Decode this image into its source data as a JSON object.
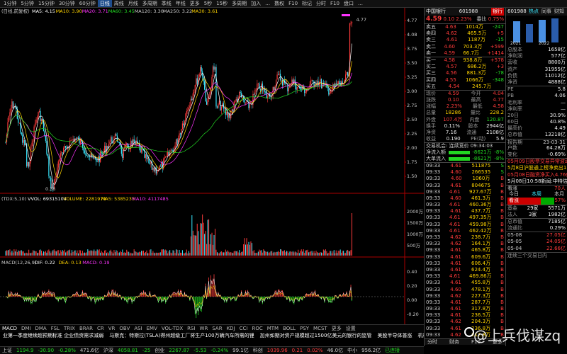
{
  "menubar": {
    "items": [
      "1分钟",
      "5分钟",
      "15分钟",
      "30分钟",
      "60分钟",
      "日线",
      "周线",
      "月线",
      "多周期",
      "季线",
      "年线",
      "更多",
      "5秒",
      "15秒",
      "多周期",
      "加入",
      "…",
      "数权",
      "F10",
      "标记",
      "分时",
      "F10",
      "盘口",
      "…"
    ],
    "active_index": 5
  },
  "chart": {
    "info": "(日线,前复权)",
    "ma_labels": [
      {
        "text": "MA5: 4.15",
        "color": "#ffffff"
      },
      {
        "text": "MA10: 3.90",
        "color": "#ffd400"
      },
      {
        "text": "MA20: 3.71",
        "color": "#ff33ff"
      },
      {
        "text": "MA60: 3.45",
        "color": "#22d822"
      },
      {
        "text": "MA120: 3.30",
        "color": "#cccccc"
      },
      {
        "text": "MA250: 3.22",
        "color": "#cccccc"
      },
      {
        "text": "MA30: 3.61",
        "color": "#ffd400"
      }
    ],
    "price_axis": [
      "4.77",
      "4.08",
      "3.75",
      "3.50",
      "3.25",
      "3.00",
      "2.75",
      "2.50",
      "2.25",
      "2.00",
      "1.75",
      "1.50"
    ],
    "high_label": "4.77",
    "low_label": "0.36",
    "vol_labels": [
      {
        "text": "(TDX:5,10)",
        "color": "#cccccc"
      },
      {
        "text": "VVOL: 69315104",
        "color": "#ffffff"
      },
      {
        "text": "VOLUME: 2281979",
        "color": "#ffd400"
      },
      {
        "text": "MA5: 5385235",
        "color": "#ffd400"
      },
      {
        "text": "MA10: 4117485",
        "color": "#ff33ff"
      }
    ],
    "vol_axis": [
      "2000万",
      "1500万",
      "1000万",
      "500万"
    ],
    "macd_labels": [
      {
        "text": "MACD(12,26,9)",
        "color": "#cccccc"
      },
      {
        "text": "DIF: 0.22",
        "color": "#ffffff"
      },
      {
        "text": "DEA: 0.13",
        "color": "#ffd400"
      },
      {
        "text": "MACD: 0.19",
        "color": "#ff33ff"
      }
    ],
    "macd_axis": [
      "0.40",
      "0.20",
      "0.00",
      "-0.20"
    ],
    "date_axis": [
      "04/29",
      "05/22"
    ]
  },
  "subtabs": [
    "MACD",
    "DMI",
    "DMA",
    "FSL",
    "TRIX",
    "BRAR",
    "CR",
    "VR",
    "OBV",
    "ASI",
    "EMV",
    "VOL-TDX",
    "RSI",
    "WR",
    "SAR",
    "KDJ",
    "CCI",
    "ROC",
    "MTM",
    "BOLL",
    "PSY",
    "MCST",
    "更多",
    "设置"
  ],
  "ticker": {
    "items": [
      {
        "text": "业第一季度继续超预期标准 企业债资需求减弱",
        "color": "#ffffff"
      },
      {
        "text": "马斯克：特斯拉(TSLA)得州超级工厂将生产100万辆汽车所需的锂",
        "color": "#ffffff"
      },
      {
        "text": "加州如期对资产规模超过1500亿美元的银行的监管",
        "color": "#ffffff"
      },
      {
        "text": "美股半导体普涨",
        "color": "#ffffff"
      },
      {
        "text": "机构：汽油价格双向波动趋于正常三个月",
        "color": "#ffffff"
      }
    ]
  },
  "status": {
    "items": [
      {
        "text": "上证",
        "color": "#cccccc"
      },
      {
        "text": "1194.9",
        "color": "#22d822"
      },
      {
        "text": "-30.90",
        "color": "#22d822"
      },
      {
        "text": "-0.28%",
        "color": "#22d822"
      },
      {
        "text": "471.6亿",
        "color": "#cccccc"
      },
      {
        "text": "沪深",
        "color": "#cccccc"
      },
      {
        "text": "4058.81",
        "color": "#22d822"
      },
      {
        "text": "-25",
        "color": "#22d822"
      },
      {
        "text": "创业",
        "color": "#cccccc"
      },
      {
        "text": "2267.87",
        "color": "#22d822"
      },
      {
        "text": "-5.53",
        "color": "#22d822"
      },
      {
        "text": "-0.24%",
        "color": "#22d822"
      },
      {
        "text": "99.1亿",
        "color": "#cccccc"
      },
      {
        "text": "科创",
        "color": "#cccccc"
      },
      {
        "text": "1039.96",
        "color": "#ff3b3b"
      },
      {
        "text": "0.21",
        "color": "#ff3b3b"
      },
      {
        "text": "0.02%",
        "color": "#ff3b3b"
      },
      {
        "text": "46.0亿",
        "color": "#cccccc"
      },
      {
        "text": "中小",
        "color": "#cccccc"
      },
      {
        "text": "956.2亿",
        "color": "#cccccc"
      },
      {
        "text": "已连接",
        "color": "#22d822"
      }
    ]
  },
  "quote": {
    "name": "中国银行",
    "code": "601988",
    "tag": "银行",
    "price": "4.59",
    "change": "0.10",
    "change_pct": "2.23%",
    "weibi": "委比",
    "weibi_val": "0.75%",
    "asks": [
      {
        "label": "卖五",
        "price": "4.63",
        "vol": "1014万",
        "chg": "-247"
      },
      {
        "label": "卖四",
        "price": "4.62",
        "vol": "465.5万",
        "chg": "+5"
      },
      {
        "label": "卖三",
        "price": "4.61",
        "vol": "1187万",
        "chg": "-15"
      },
      {
        "label": "卖二",
        "price": "4.60",
        "vol": "703.3万",
        "chg": "+599"
      },
      {
        "label": "卖一",
        "price": "4.59",
        "vol": "66.7万",
        "chg": "+1414"
      }
    ],
    "bids": [
      {
        "label": "买一",
        "price": "4.58",
        "vol": "938.8万",
        "chg": "+578"
      },
      {
        "label": "买二",
        "price": "4.57",
        "vol": "686.2万",
        "chg": "+3"
      },
      {
        "label": "买三",
        "price": "4.56",
        "vol": "881.3万",
        "chg": "-78"
      },
      {
        "label": "买四",
        "price": "4.55",
        "vol": "1066万",
        "chg": "-348"
      },
      {
        "label": "买五",
        "price": "4.54",
        "vol": "245.7万",
        "chg": ""
      }
    ],
    "stats": [
      {
        "l": "现价",
        "v": "4.59",
        "c": "#ff3b3b",
        "l2": "今开",
        "v2": "4.04",
        "c2": "#ff3b3b"
      },
      {
        "l": "涨跌",
        "v": "0.10",
        "c": "#ff3b3b",
        "l2": "最高",
        "v2": "4.77",
        "c2": "#ff3b3b"
      },
      {
        "l": "涨幅",
        "v": "2.23%",
        "c": "#ff3b3b",
        "l2": "最低",
        "v2": "4.58",
        "c2": "#ff3b3b"
      },
      {
        "l": "总量",
        "v": "18286",
        "c": "#ffd400",
        "l2": "量比",
        "v2": "228.2",
        "c2": "#ffd400"
      },
      {
        "l": "外盘",
        "v": "107.4万",
        "c": "#ff3b3b",
        "l2": "内盘",
        "v2": "120.87",
        "c2": "#22d822"
      },
      {
        "l": "换手",
        "v": "0.11%",
        "c": "#eee",
        "l2": "股本",
        "v2": "2944亿",
        "c2": "#eee"
      },
      {
        "l": "净资",
        "v": "7.16",
        "c": "#eee",
        "l2": "流通",
        "v2": "2108亿",
        "c2": "#eee"
      },
      {
        "l": "收益",
        "v": "0.190",
        "c": "#eee",
        "l2": "PE(动)",
        "v2": "5.9",
        "c2": "#eee"
      }
    ],
    "flow_title": "交易机会: 连续竞价 09:34:03",
    "flows": [
      {
        "label": "净流入额",
        "val": "-8621万",
        "pct": "-8%"
      },
      {
        "label": "大单流入",
        "val": "-8621万",
        "pct": "-8%"
      }
    ],
    "ticks": [
      {
        "t": "09:33",
        "p": "4.61",
        "v": "511875",
        "d": "S"
      },
      {
        "t": "09:33",
        "p": "4.60",
        "v": "266535",
        "d": "S"
      },
      {
        "t": "09:33",
        "p": "4.60",
        "v": "1060万",
        "d": "B"
      },
      {
        "t": "09:33",
        "p": "4.61",
        "v": "804675",
        "d": "B"
      },
      {
        "t": "09:33",
        "p": "4.61",
        "v": "927.67万",
        "d": "B"
      },
      {
        "t": "09:33",
        "p": "4.60",
        "v": "461.3万",
        "d": "B"
      },
      {
        "t": "09:33",
        "p": "4.61",
        "v": "460.36万",
        "d": "B"
      },
      {
        "t": "09:33",
        "p": "4.61",
        "v": "437.7万",
        "d": "B"
      },
      {
        "t": "09:33",
        "p": "4.61",
        "v": "497.35万",
        "d": "B"
      },
      {
        "t": "09:33",
        "p": "4.61",
        "v": "459.98万",
        "d": "B"
      },
      {
        "t": "09:33",
        "p": "4.61",
        "v": "462.42万",
        "d": "B"
      },
      {
        "t": "09:33",
        "p": "4.62",
        "v": "238.7万",
        "d": "B"
      },
      {
        "t": "09:33",
        "p": "4.62",
        "v": "164.1万",
        "d": "B"
      },
      {
        "t": "09:33",
        "p": "4.61",
        "v": "465.8万",
        "d": "B"
      },
      {
        "t": "09:33",
        "p": "4.61",
        "v": "609.6万",
        "d": "B"
      },
      {
        "t": "09:33",
        "p": "4.61",
        "v": "606.4万",
        "d": "B"
      },
      {
        "t": "09:33",
        "p": "4.61",
        "v": "624.4万",
        "d": "B"
      },
      {
        "t": "09:33",
        "p": "4.61",
        "v": "469.86万",
        "d": "B"
      },
      {
        "t": "09:33",
        "p": "4.61",
        "v": "455.8万",
        "d": "B"
      },
      {
        "t": "09:33",
        "p": "4.60",
        "v": "478.1万",
        "d": "B"
      },
      {
        "t": "09:33",
        "p": "4.62",
        "v": "227.3万",
        "d": "B"
      },
      {
        "t": "09:33",
        "p": "4.61",
        "v": "287.7万",
        "d": "B"
      },
      {
        "t": "09:33",
        "p": "4.61",
        "v": "317.8万",
        "d": "B"
      },
      {
        "t": "09:33",
        "p": "4.61",
        "v": "236.5万",
        "d": "B"
      },
      {
        "t": "09:33",
        "p": "4.62",
        "v": "204.3万",
        "d": "B"
      },
      {
        "t": "09:33",
        "p": "4.61",
        "v": "236.8万",
        "d": "B"
      },
      {
        "t": "09:33",
        "p": "4.62",
        "v": "212.8万",
        "d": "B"
      },
      {
        "t": "09:33",
        "p": "4.60",
        "v": "189.9万",
        "d": "B"
      }
    ],
    "bottom_tabs": [
      "分时",
      "财务",
      "F10",
      "更多"
    ]
  },
  "right": {
    "code": "601988",
    "tabs": [
      "热点",
      "同事",
      "财知"
    ],
    "years": [
      "2021",
      "2022"
    ],
    "info": [
      {
        "l": "总股本",
        "v": "1658亿"
      },
      {
        "l": "净利润",
        "v": "577亿"
      },
      {
        "l": "营收",
        "v": "8800万"
      },
      {
        "l": "资产",
        "v": "31955亿"
      },
      {
        "l": "负债",
        "v": "11012亿"
      },
      {
        "l": "净资",
        "v": "4888亿"
      }
    ],
    "metrics": [
      {
        "l": "PE",
        "v": "5.8"
      },
      {
        "l": "PB",
        "v": "4.06"
      },
      {
        "l": "毛利率",
        "v": "—"
      },
      {
        "l": "净利率",
        "v": "—"
      },
      {
        "l": "20日",
        "v": "30.9%"
      },
      {
        "l": "60日",
        "v": "40.8%"
      },
      {
        "l": "最高价",
        "v": "4.49"
      },
      {
        "l": "总市值",
        "v": "13218亿"
      }
    ],
    "report_date": "23-03-31",
    "report_rows": [
      {
        "l": "户数",
        "v": "64.28万"
      },
      {
        "l": "变化",
        "v": "-0.69%"
      }
    ],
    "news": [
      {
        "t": "05月09日股票交易异常波动",
        "c": "#ff3b3b"
      },
      {
        "t": "5月8日沪股通上榜净卖出1",
        "c": "#ffd400"
      },
      {
        "t": "05月08日融资净买入4.76亿",
        "c": "#ff3b3b"
      },
      {
        "t": "5月08日10:58新闻:中特估-",
        "c": "#eee"
      }
    ],
    "sentiment": {
      "l": "看涨",
      "v": "70人"
    },
    "flow_tabs": [
      "今日",
      "本周",
      "本月"
    ],
    "bars": [
      {
        "l": "看涨",
        "pct": "57%"
      }
    ],
    "holders": [
      {
        "l": "基金",
        "a": "29家",
        "v": "5571万"
      },
      {
        "l": "法人",
        "a": "3家",
        "v": "1982亿"
      }
    ],
    "cap": [
      {
        "l": "总市值",
        "v": "7185亿"
      },
      {
        "l": "流通比",
        "v": "0.29%"
      }
    ],
    "dates": [
      {
        "d": "05-08",
        "v": "27.05亿"
      },
      {
        "d": "05-05",
        "v": "24.05亿"
      },
      {
        "d": "05-04",
        "v": "22.66亿"
      }
    ],
    "footer": "连续三个交易日内"
  },
  "watermark": "@上兵伐谋zq"
}
